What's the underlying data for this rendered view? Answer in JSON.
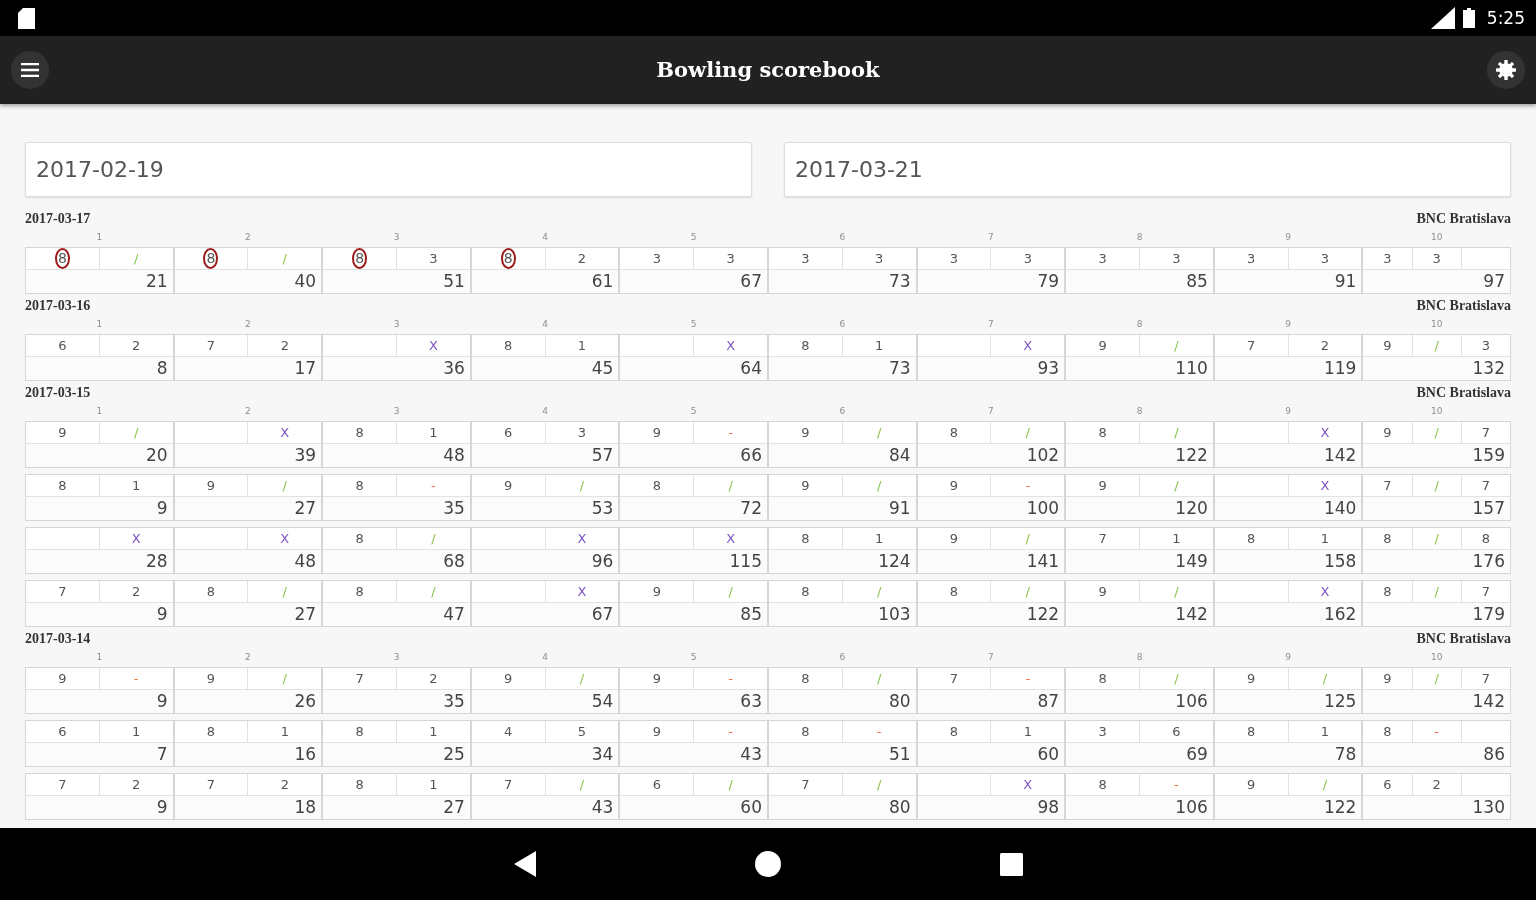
{
  "status_bar": {
    "time": "5:25"
  },
  "app_bar": {
    "title": "Bowling scorebook"
  },
  "date_fields": [
    {
      "value": "2017-02-19"
    },
    {
      "value": "2017-03-21"
    }
  ],
  "sessions": [
    {
      "date": "2017-03-17",
      "venue": "BNC Bratislava",
      "frame_numbers": [
        "1",
        "2",
        "3",
        "4",
        "5",
        "6",
        "7",
        "8",
        "9",
        "10"
      ],
      "games": [
        {
          "frames": [
            {
              "rolls": [
                "8",
                "/"
              ],
              "kind": "spare",
              "split": true,
              "score": "21"
            },
            {
              "rolls": [
                "8",
                "/"
              ],
              "kind": "spare",
              "split": true,
              "score": "40"
            },
            {
              "rolls": [
                "8",
                "3"
              ],
              "kind": "open",
              "split": true,
              "score": "51"
            },
            {
              "rolls": [
                "8",
                "2"
              ],
              "kind": "open",
              "split": true,
              "score": "61"
            },
            {
              "rolls": [
                "3",
                "3"
              ],
              "kind": "open",
              "split": false,
              "score": "67"
            },
            {
              "rolls": [
                "3",
                "3"
              ],
              "kind": "open",
              "split": false,
              "score": "73"
            },
            {
              "rolls": [
                "3",
                "3"
              ],
              "kind": "open",
              "split": false,
              "score": "79"
            },
            {
              "rolls": [
                "3",
                "3"
              ],
              "kind": "open",
              "split": false,
              "score": "85"
            },
            {
              "rolls": [
                "3",
                "3"
              ],
              "kind": "open",
              "split": false,
              "score": "91"
            },
            {
              "rolls": [
                "3",
                "3"
              ],
              "kind": "open",
              "split": false,
              "score": "97"
            }
          ]
        }
      ]
    },
    {
      "date": "2017-03-16",
      "venue": "BNC Bratislava",
      "frame_numbers": [
        "1",
        "2",
        "3",
        "4",
        "5",
        "6",
        "7",
        "8",
        "9",
        "10"
      ],
      "games": [
        {
          "frames": [
            {
              "rolls": [
                "6",
                "2"
              ],
              "kind": "open",
              "split": false,
              "score": "8"
            },
            {
              "rolls": [
                "7",
                "2"
              ],
              "kind": "open",
              "split": false,
              "score": "17"
            },
            {
              "rolls": [
                "X"
              ],
              "kind": "strike",
              "split": false,
              "score": "36"
            },
            {
              "rolls": [
                "8",
                "1"
              ],
              "kind": "open",
              "split": false,
              "score": "45"
            },
            {
              "rolls": [
                "X"
              ],
              "kind": "strike",
              "split": false,
              "score": "64"
            },
            {
              "rolls": [
                "8",
                "1"
              ],
              "kind": "open",
              "split": false,
              "score": "73"
            },
            {
              "rolls": [
                "X"
              ],
              "kind": "strike",
              "split": false,
              "score": "93"
            },
            {
              "rolls": [
                "9",
                "/"
              ],
              "kind": "spare",
              "split": false,
              "score": "110"
            },
            {
              "rolls": [
                "7",
                "2"
              ],
              "kind": "open",
              "split": false,
              "score": "119"
            },
            {
              "rolls": [
                "9",
                "/",
                "3"
              ],
              "kind": "spare",
              "split": false,
              "score": "132"
            }
          ]
        }
      ]
    },
    {
      "date": "2017-03-15",
      "venue": "BNC Bratislava",
      "frame_numbers": [
        "1",
        "2",
        "3",
        "4",
        "5",
        "6",
        "7",
        "8",
        "9",
        "10"
      ],
      "games": [
        {
          "frames": [
            {
              "rolls": [
                "9",
                "/"
              ],
              "kind": "spare",
              "split": false,
              "score": "20"
            },
            {
              "rolls": [
                "X"
              ],
              "kind": "strike",
              "split": false,
              "score": "39"
            },
            {
              "rolls": [
                "8",
                "1"
              ],
              "kind": "open",
              "split": false,
              "score": "48"
            },
            {
              "rolls": [
                "6",
                "3"
              ],
              "kind": "open",
              "split": false,
              "score": "57"
            },
            {
              "rolls": [
                "9",
                "-"
              ],
              "kind": "miss",
              "split": false,
              "score": "66"
            },
            {
              "rolls": [
                "9",
                "/"
              ],
              "kind": "spare",
              "split": false,
              "score": "84"
            },
            {
              "rolls": [
                "8",
                "/"
              ],
              "kind": "spare",
              "split": false,
              "score": "102"
            },
            {
              "rolls": [
                "8",
                "/"
              ],
              "kind": "spare",
              "split": false,
              "score": "122"
            },
            {
              "rolls": [
                "X"
              ],
              "kind": "strike",
              "split": false,
              "score": "142"
            },
            {
              "rolls": [
                "9",
                "/",
                "7"
              ],
              "kind": "spare",
              "split": false,
              "score": "159"
            }
          ]
        },
        {
          "frames": [
            {
              "rolls": [
                "8",
                "1"
              ],
              "kind": "open",
              "split": false,
              "score": "9"
            },
            {
              "rolls": [
                "9",
                "/"
              ],
              "kind": "spare",
              "split": false,
              "score": "27"
            },
            {
              "rolls": [
                "8",
                "-"
              ],
              "kind": "miss",
              "split": false,
              "score": "35"
            },
            {
              "rolls": [
                "9",
                "/"
              ],
              "kind": "spare",
              "split": false,
              "score": "53"
            },
            {
              "rolls": [
                "8",
                "/"
              ],
              "kind": "spare",
              "split": false,
              "score": "72"
            },
            {
              "rolls": [
                "9",
                "/"
              ],
              "kind": "spare",
              "split": false,
              "score": "91"
            },
            {
              "rolls": [
                "9",
                "-"
              ],
              "kind": "miss",
              "split": false,
              "score": "100"
            },
            {
              "rolls": [
                "9",
                "/"
              ],
              "kind": "spare",
              "split": false,
              "score": "120"
            },
            {
              "rolls": [
                "X"
              ],
              "kind": "strike",
              "split": false,
              "score": "140"
            },
            {
              "rolls": [
                "7",
                "/",
                "7"
              ],
              "kind": "spare",
              "split": false,
              "score": "157"
            }
          ]
        },
        {
          "frames": [
            {
              "rolls": [
                "X"
              ],
              "kind": "strike",
              "split": false,
              "score": "28"
            },
            {
              "rolls": [
                "X"
              ],
              "kind": "strike",
              "split": false,
              "score": "48"
            },
            {
              "rolls": [
                "8",
                "/"
              ],
              "kind": "spare",
              "split": false,
              "score": "68"
            },
            {
              "rolls": [
                "X"
              ],
              "kind": "strike",
              "split": false,
              "score": "96"
            },
            {
              "rolls": [
                "X"
              ],
              "kind": "strike",
              "split": false,
              "score": "115"
            },
            {
              "rolls": [
                "8",
                "1"
              ],
              "kind": "open",
              "split": false,
              "score": "124"
            },
            {
              "rolls": [
                "9",
                "/"
              ],
              "kind": "spare",
              "split": false,
              "score": "141"
            },
            {
              "rolls": [
                "7",
                "1"
              ],
              "kind": "open",
              "split": false,
              "score": "149"
            },
            {
              "rolls": [
                "8",
                "1"
              ],
              "kind": "open",
              "split": false,
              "score": "158"
            },
            {
              "rolls": [
                "8",
                "/",
                "8"
              ],
              "kind": "spare",
              "split": false,
              "score": "176"
            }
          ]
        },
        {
          "frames": [
            {
              "rolls": [
                "7",
                "2"
              ],
              "kind": "open",
              "split": false,
              "score": "9"
            },
            {
              "rolls": [
                "8",
                "/"
              ],
              "kind": "spare",
              "split": false,
              "score": "27"
            },
            {
              "rolls": [
                "8",
                "/"
              ],
              "kind": "spare",
              "split": false,
              "score": "47"
            },
            {
              "rolls": [
                "X"
              ],
              "kind": "strike",
              "split": false,
              "score": "67"
            },
            {
              "rolls": [
                "9",
                "/"
              ],
              "kind": "spare",
              "split": false,
              "score": "85"
            },
            {
              "rolls": [
                "8",
                "/"
              ],
              "kind": "spare",
              "split": false,
              "score": "103"
            },
            {
              "rolls": [
                "8",
                "/"
              ],
              "kind": "spare",
              "split": false,
              "score": "122"
            },
            {
              "rolls": [
                "9",
                "/"
              ],
              "kind": "spare",
              "split": false,
              "score": "142"
            },
            {
              "rolls": [
                "X"
              ],
              "kind": "strike",
              "split": false,
              "score": "162"
            },
            {
              "rolls": [
                "8",
                "/",
                "7"
              ],
              "kind": "spare",
              "split": false,
              "score": "179"
            }
          ]
        }
      ]
    },
    {
      "date": "2017-03-14",
      "venue": "BNC Bratislava",
      "frame_numbers": [
        "1",
        "2",
        "3",
        "4",
        "5",
        "6",
        "7",
        "8",
        "9",
        "10"
      ],
      "games": [
        {
          "frames": [
            {
              "rolls": [
                "9",
                "-"
              ],
              "kind": "miss",
              "split": false,
              "score": "9"
            },
            {
              "rolls": [
                "9",
                "/"
              ],
              "kind": "spare",
              "split": false,
              "score": "26"
            },
            {
              "rolls": [
                "7",
                "2"
              ],
              "kind": "open",
              "split": false,
              "score": "35"
            },
            {
              "rolls": [
                "9",
                "/"
              ],
              "kind": "spare",
              "split": false,
              "score": "54"
            },
            {
              "rolls": [
                "9",
                "-"
              ],
              "kind": "miss",
              "split": false,
              "score": "63"
            },
            {
              "rolls": [
                "8",
                "/"
              ],
              "kind": "spare",
              "split": false,
              "score": "80"
            },
            {
              "rolls": [
                "7",
                "-"
              ],
              "kind": "miss",
              "split": false,
              "score": "87"
            },
            {
              "rolls": [
                "8",
                "/"
              ],
              "kind": "spare",
              "split": false,
              "score": "106"
            },
            {
              "rolls": [
                "9",
                "/"
              ],
              "kind": "spare",
              "split": false,
              "score": "125"
            },
            {
              "rolls": [
                "9",
                "/",
                "7"
              ],
              "kind": "spare",
              "split": false,
              "score": "142"
            }
          ]
        },
        {
          "frames": [
            {
              "rolls": [
                "6",
                "1"
              ],
              "kind": "open",
              "split": false,
              "score": "7"
            },
            {
              "rolls": [
                "8",
                "1"
              ],
              "kind": "open",
              "split": false,
              "score": "16"
            },
            {
              "rolls": [
                "8",
                "1"
              ],
              "kind": "open",
              "split": false,
              "score": "25"
            },
            {
              "rolls": [
                "4",
                "5"
              ],
              "kind": "open",
              "split": false,
              "score": "34"
            },
            {
              "rolls": [
                "9",
                "-"
              ],
              "kind": "miss",
              "split": false,
              "score": "43"
            },
            {
              "rolls": [
                "8",
                "-"
              ],
              "kind": "miss",
              "split": false,
              "score": "51"
            },
            {
              "rolls": [
                "8",
                "1"
              ],
              "kind": "open",
              "split": false,
              "score": "60"
            },
            {
              "rolls": [
                "3",
                "6"
              ],
              "kind": "open",
              "split": false,
              "score": "69"
            },
            {
              "rolls": [
                "8",
                "1"
              ],
              "kind": "open",
              "split": false,
              "score": "78"
            },
            {
              "rolls": [
                "8",
                "-"
              ],
              "kind": "miss",
              "split": false,
              "score": "86"
            }
          ]
        },
        {
          "frames": [
            {
              "rolls": [
                "7",
                "2"
              ],
              "kind": "open",
              "split": false,
              "score": "9"
            },
            {
              "rolls": [
                "7",
                "2"
              ],
              "kind": "open",
              "split": false,
              "score": "18"
            },
            {
              "rolls": [
                "8",
                "1"
              ],
              "kind": "open",
              "split": false,
              "score": "27"
            },
            {
              "rolls": [
                "7",
                "/"
              ],
              "kind": "spare",
              "split": false,
              "score": "43"
            },
            {
              "rolls": [
                "6",
                "/"
              ],
              "kind": "spare",
              "split": false,
              "score": "60"
            },
            {
              "rolls": [
                "7",
                "/"
              ],
              "kind": "spare",
              "split": false,
              "score": "80"
            },
            {
              "rolls": [
                "X"
              ],
              "kind": "strike",
              "split": false,
              "score": "98"
            },
            {
              "rolls": [
                "8",
                "-"
              ],
              "kind": "miss",
              "split": false,
              "score": "106"
            },
            {
              "rolls": [
                "9",
                "/"
              ],
              "kind": "spare",
              "split": false,
              "score": "122"
            },
            {
              "rolls": [
                "6",
                "2"
              ],
              "kind": "open",
              "split": false,
              "score": "130"
            }
          ]
        }
      ]
    }
  ]
}
